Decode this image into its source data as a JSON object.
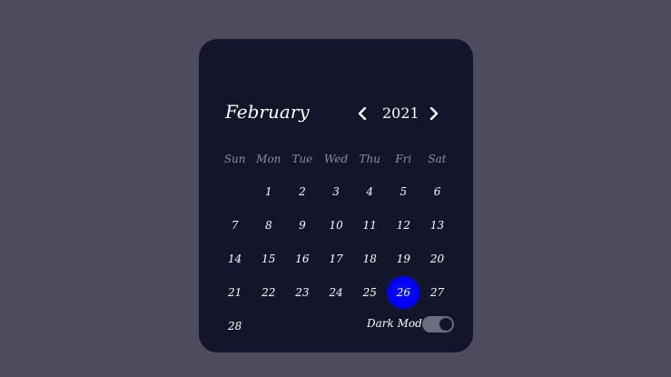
{
  "header": {
    "month": "February",
    "year": "2021"
  },
  "weekdays": [
    "Sun",
    "Mon",
    "Tue",
    "Wed",
    "Thu",
    "Fri",
    "Sat"
  ],
  "days": [
    "1",
    "2",
    "3",
    "4",
    "5",
    "6",
    "7",
    "8",
    "9",
    "10",
    "11",
    "12",
    "13",
    "14",
    "15",
    "16",
    "17",
    "18",
    "19",
    "20",
    "21",
    "22",
    "23",
    "24",
    "25",
    "26",
    "27",
    "28"
  ],
  "first_weekday_index": 1,
  "selected_day": "26",
  "settings": {
    "dark_mode_label": "Dark Mode",
    "dark_mode_on": true
  },
  "colors": {
    "background": "#504c5f",
    "card": "#13152b",
    "selected": "#0000ff",
    "weekday_text": "#8a8da3",
    "toggle_track": "#6b6e80"
  },
  "icons": {
    "prev": "chevron-left-icon",
    "next": "chevron-right-icon"
  }
}
